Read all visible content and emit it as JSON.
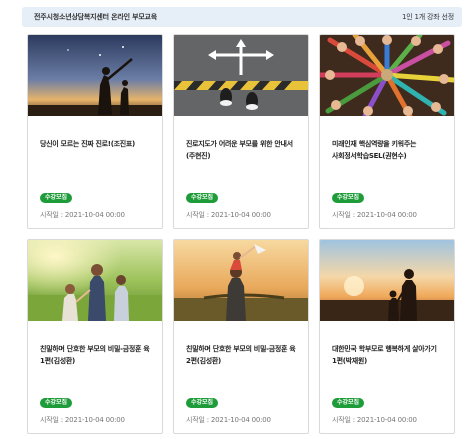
{
  "header": {
    "title": "전주시청소년상담복지센터 온라인 부모교육",
    "note": "1인 1개 강좌 선정"
  },
  "courses": [
    {
      "title": "당신이 모르는 진짜 진로!(조진표)",
      "badge": "수강모집",
      "start": "시작일 : 2021-10-04 00:00",
      "thumb": "silhouettes-pointing-sky"
    },
    {
      "title": "진로지도가 어려운 부모를 위한 안내서(주현진)",
      "badge": "수강모집",
      "start": "시작일 : 2021-10-04 00:00",
      "thumb": "feet-at-road-arrows"
    },
    {
      "title": "미래인재 핵심역량을 키워주는 사회정서학습SEL(권현수)",
      "badge": "수강모집",
      "start": "시작일 : 2021-10-04 00:00",
      "thumb": "hands-crayons-circle"
    },
    {
      "title": "친밀하며 단호한 부모의 비밀-금정훈 육 1편(김성환)",
      "badge": "수강모집",
      "start": "시작일 : 2021-10-04 00:00",
      "thumb": "family-walking-field"
    },
    {
      "title": "친밀하며 단호한 부모의 비밀-금정훈 육 2편(김성환)",
      "badge": "수강모집",
      "start": "시작일 : 2021-10-04 00:00",
      "thumb": "child-on-shoulders"
    },
    {
      "title": "대한민국 학부모로 행복하게 살아가기 1편(박재원)",
      "badge": "수강모집",
      "start": "시작일 : 2021-10-04 00:00",
      "thumb": "parent-child-sunset"
    }
  ]
}
